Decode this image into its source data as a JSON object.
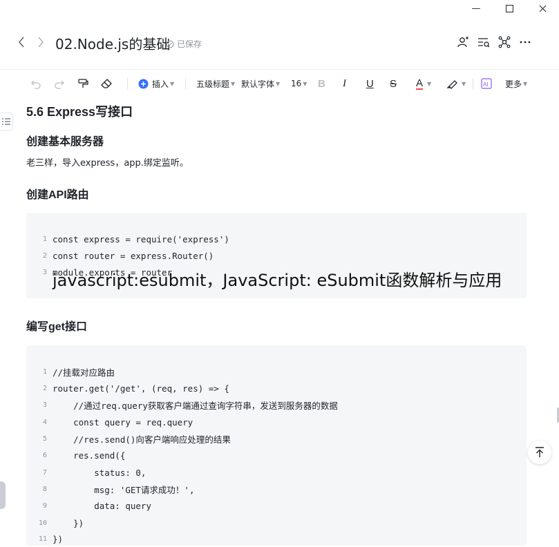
{
  "window": {
    "minimize_glyph": "—",
    "maximize_glyph": "☐",
    "close_glyph": "✕"
  },
  "header": {
    "title": "02.Node.js的基础",
    "saved_status": "已保存",
    "icons": [
      "back-icon",
      "forward-icon",
      "share-user-icon",
      "outline-search-icon",
      "mindmap-icon",
      "more-icon"
    ]
  },
  "toolbar": {
    "insert_label": "插入",
    "heading_label": "五级标题",
    "font_label": "默认字体",
    "size_label": "16",
    "more_label": "更多",
    "accent_color": "#3370ff",
    "text_color_underline": "#f54a45"
  },
  "doc": {
    "heading_main": "5.6 Express写接口",
    "section1_title": "创建基本服务器",
    "section1_text": "老三样，导入express，app.绑定监听。",
    "section2_title": "创建API路由",
    "code1": [
      {
        "n": "1",
        "text": "const express = require('express')"
      },
      {
        "n": "2",
        "text": "const router = express.Router()"
      },
      {
        "n": "3",
        "text": "module.exports = router"
      }
    ],
    "section3_title": "编写get接口",
    "code2": [
      {
        "n": "1",
        "text": "//挂载对应路由"
      },
      {
        "n": "2",
        "text": "router.get('/get', (req, res) => {"
      },
      {
        "n": "3",
        "text": "    //通过req.query获取客户端通过查询字符串，发送到服务器的数据"
      },
      {
        "n": "4",
        "text": "    const query = req.query"
      },
      {
        "n": "5",
        "text": "    //res.send()向客户端响应处理的结果"
      },
      {
        "n": "6",
        "text": "    res.send({"
      },
      {
        "n": "7",
        "text": "        status: 0,"
      },
      {
        "n": "8",
        "text": "        msg: 'GET请求成功！',"
      },
      {
        "n": "9",
        "text": "        data: query"
      },
      {
        "n": "10",
        "text": "    })"
      },
      {
        "n": "11",
        "text": "})"
      }
    ]
  },
  "overlay_caption": "javascript:esubmit，JavaScript: eSubmit函数解析与应用"
}
